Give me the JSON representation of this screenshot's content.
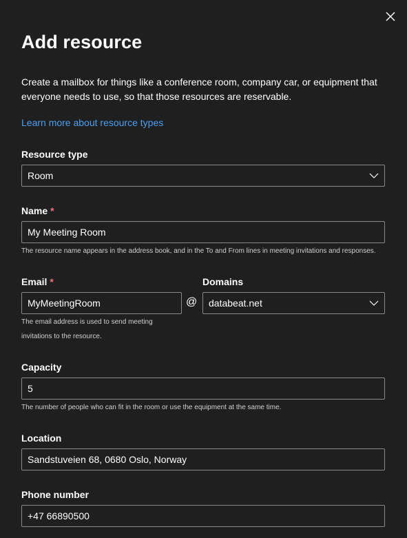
{
  "panel": {
    "title": "Add resource",
    "description": "Create a mailbox for things like a conference room, company car, or equipment that everyone needs to use, so that those resources are reservable.",
    "learn_more_link": "Learn more about resource types"
  },
  "form": {
    "resource_type": {
      "label": "Resource type",
      "value": "Room"
    },
    "name": {
      "label": "Name",
      "required_mark": "*",
      "value": "My Meeting Room",
      "help": "The resource name appears in the address book, and in the To and From lines in meeting invitations and responses."
    },
    "email": {
      "label": "Email",
      "required_mark": "*",
      "value": "MyMeetingRoom",
      "at_symbol": "@",
      "help_line1": "The email address is used to send meeting",
      "help_line2": "invitations to the resource."
    },
    "domains": {
      "label": "Domains",
      "value": "databeat.net"
    },
    "capacity": {
      "label": "Capacity",
      "value": "5",
      "help": "The number of people who can fit in the room or use the equipment at the same time."
    },
    "location": {
      "label": "Location",
      "value": "Sandstuveien 68, 0680 Oslo, Norway"
    },
    "phone": {
      "label": "Phone number",
      "value": "+47 66890500"
    }
  },
  "icons": {
    "close": "close-icon",
    "dropdown": "chevron-down-icon"
  },
  "colors": {
    "background": "#1f1f1f",
    "link": "#4aa0f0",
    "required": "#f1707b",
    "border": "#8a8a8a"
  }
}
